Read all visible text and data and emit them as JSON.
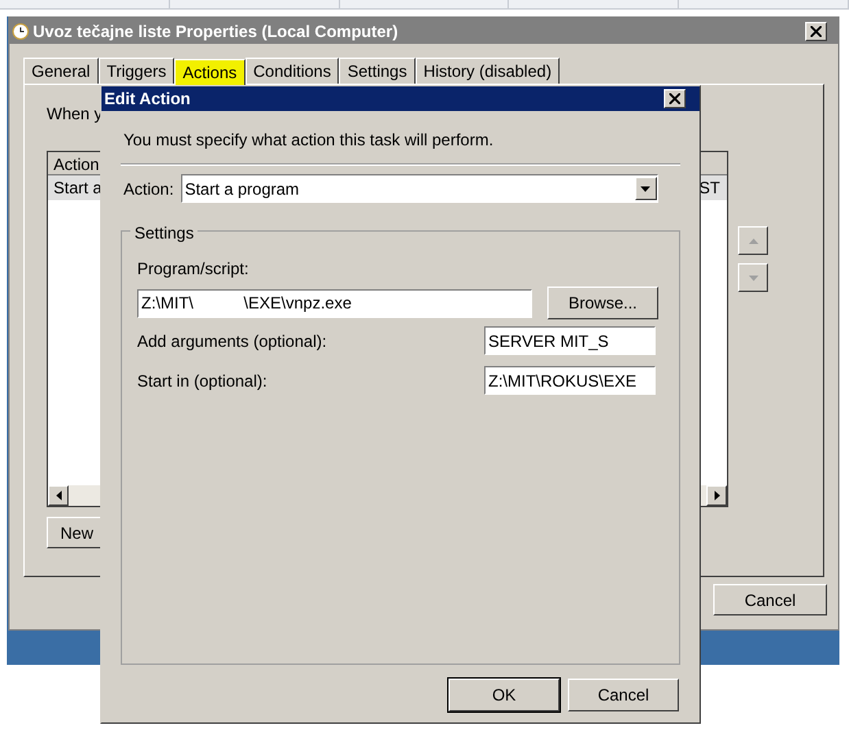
{
  "properties_window": {
    "title": "Uvoz tečajne liste Properties (Local Computer)",
    "tabs": [
      {
        "label": "General",
        "selected": false
      },
      {
        "label": "Triggers",
        "selected": false
      },
      {
        "label": "Actions",
        "selected": true
      },
      {
        "label": "Conditions",
        "selected": false
      },
      {
        "label": "Settings",
        "selected": false
      },
      {
        "label": "History (disabled)",
        "selected": false
      }
    ],
    "intro": "When y",
    "actions_list": {
      "column": "Action",
      "rows": [
        {
          "cell": "Start a",
          "cell_2": "ST",
          "selected": true
        }
      ]
    },
    "new_button": "New",
    "cancel_button": "Cancel"
  },
  "edit_action_dialog": {
    "title": "Edit Action",
    "instruction": "You must specify what action this task will perform.",
    "action_label": "Action:",
    "action_value": "Start a program",
    "settings_group": "Settings",
    "program_label": "Program/script:",
    "program_value": "Z:\\MIT\\           \\EXE\\vnpz.exe",
    "browse_button": "Browse...",
    "arguments_label": "Add arguments (optional):",
    "arguments_value": "SERVER MIT_S",
    "start_in_label": "Start in (optional):",
    "start_in_value": "Z:\\MIT\\ROKUS\\EXE",
    "ok_button": "OK",
    "cancel_button": "Cancel"
  }
}
